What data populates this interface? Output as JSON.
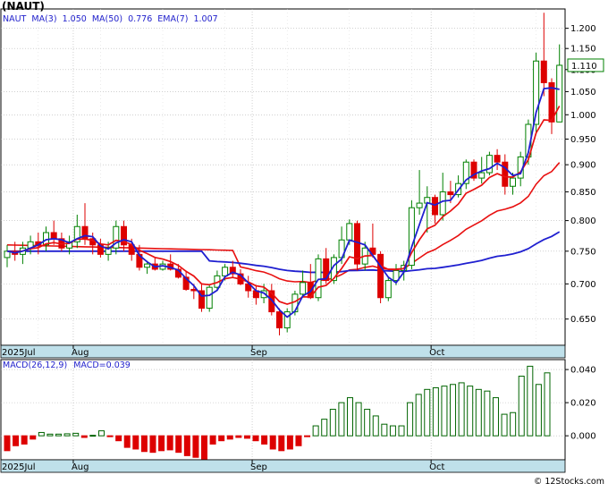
{
  "ticker": "(NAUT)",
  "legend": {
    "ma3": "MA(3)",
    "ma3_val": "1.050",
    "ma50": "MA(50)",
    "ma50_val": "0.776",
    "ema7": "EMA(7)",
    "ema7_val": "1.007"
  },
  "macd_legend": {
    "label": "MACD(26,12,9)",
    "value": "MACD=0.039"
  },
  "credit": "© 12Stocks.com",
  "last_price": "1.110",
  "colors": {
    "up": "#008000",
    "down": "#dd0000",
    "ma_blue": "#1f1fd0",
    "ma_red": "#e81010",
    "grid": "#b4b4b4",
    "axis_band": "#bfe0ea",
    "macd_bar": "#006400"
  },
  "chart_data": [
    {
      "type": "candlestick",
      "title": "(NAUT)",
      "x_labels": [
        "2025Jul",
        "Aug",
        "Sep",
        "Oct"
      ],
      "y_ticks": [
        "0.650",
        "0.700",
        "0.750",
        "0.800",
        "0.850",
        "0.900",
        "0.950",
        "1.000",
        "1.050",
        "1.100",
        "1.150",
        "1.200"
      ],
      "y_scale": "log",
      "ylim": [
        0.615,
        1.25
      ],
      "grid": true,
      "candles": [
        [
          0.74,
          0.76,
          0.725,
          0.75
        ],
        [
          0.75,
          0.765,
          0.735,
          0.745
        ],
        [
          0.745,
          0.765,
          0.73,
          0.755
        ],
        [
          0.755,
          0.775,
          0.745,
          0.765
        ],
        [
          0.765,
          0.78,
          0.745,
          0.76
        ],
        [
          0.76,
          0.79,
          0.75,
          0.78
        ],
        [
          0.78,
          0.8,
          0.76,
          0.77
        ],
        [
          0.77,
          0.78,
          0.75,
          0.755
        ],
        [
          0.755,
          0.775,
          0.745,
          0.765
        ],
        [
          0.765,
          0.81,
          0.755,
          0.79
        ],
        [
          0.79,
          0.83,
          0.76,
          0.77
        ],
        [
          0.77,
          0.78,
          0.745,
          0.76
        ],
        [
          0.76,
          0.77,
          0.74,
          0.745
        ],
        [
          0.745,
          0.765,
          0.735,
          0.755
        ],
        [
          0.755,
          0.8,
          0.745,
          0.79
        ],
        [
          0.79,
          0.8,
          0.75,
          0.76
        ],
        [
          0.76,
          0.77,
          0.735,
          0.745
        ],
        [
          0.745,
          0.76,
          0.72,
          0.725
        ],
        [
          0.725,
          0.735,
          0.715,
          0.73
        ],
        [
          0.73,
          0.74,
          0.72,
          0.722
        ],
        [
          0.722,
          0.735,
          0.72,
          0.73
        ],
        [
          0.73,
          0.745,
          0.72,
          0.722
        ],
        [
          0.722,
          0.73,
          0.708,
          0.71
        ],
        [
          0.71,
          0.72,
          0.69,
          0.692
        ],
        [
          0.692,
          0.7,
          0.678,
          0.69
        ],
        [
          0.69,
          0.7,
          0.66,
          0.665
        ],
        [
          0.665,
          0.7,
          0.66,
          0.695
        ],
        [
          0.695,
          0.72,
          0.69,
          0.712
        ],
        [
          0.712,
          0.73,
          0.705,
          0.725
        ],
        [
          0.725,
          0.735,
          0.71,
          0.715
        ],
        [
          0.715,
          0.722,
          0.698,
          0.7
        ],
        [
          0.7,
          0.712,
          0.68,
          0.69
        ],
        [
          0.69,
          0.698,
          0.67,
          0.68
        ],
        [
          0.68,
          0.7,
          0.672,
          0.69
        ],
        [
          0.69,
          0.7,
          0.655,
          0.66
        ],
        [
          0.66,
          0.665,
          0.628,
          0.638
        ],
        [
          0.638,
          0.665,
          0.632,
          0.66
        ],
        [
          0.66,
          0.69,
          0.655,
          0.685
        ],
        [
          0.685,
          0.72,
          0.68,
          0.702
        ],
        [
          0.702,
          0.73,
          0.678,
          0.68
        ],
        [
          0.68,
          0.745,
          0.675,
          0.738
        ],
        [
          0.738,
          0.755,
          0.7,
          0.705
        ],
        [
          0.705,
          0.745,
          0.7,
          0.74
        ],
        [
          0.74,
          0.79,
          0.73,
          0.768
        ],
        [
          0.768,
          0.802,
          0.76,
          0.795
        ],
        [
          0.795,
          0.8,
          0.72,
          0.73
        ],
        [
          0.73,
          0.765,
          0.72,
          0.755
        ],
        [
          0.755,
          0.795,
          0.74,
          0.745
        ],
        [
          0.745,
          0.75,
          0.672,
          0.68
        ],
        [
          0.68,
          0.71,
          0.675,
          0.705
        ],
        [
          0.705,
          0.73,
          0.698,
          0.72
        ],
        [
          0.72,
          0.735,
          0.705,
          0.728
        ],
        [
          0.728,
          0.835,
          0.722,
          0.822
        ],
        [
          0.822,
          0.89,
          0.81,
          0.83
        ],
        [
          0.83,
          0.86,
          0.78,
          0.84
        ],
        [
          0.84,
          0.845,
          0.795,
          0.81
        ],
        [
          0.81,
          0.885,
          0.8,
          0.85
        ],
        [
          0.85,
          0.87,
          0.83,
          0.845
        ],
        [
          0.845,
          0.88,
          0.84,
          0.865
        ],
        [
          0.865,
          0.91,
          0.855,
          0.905
        ],
        [
          0.905,
          0.91,
          0.87,
          0.875
        ],
        [
          0.875,
          0.915,
          0.865,
          0.885
        ],
        [
          0.885,
          0.925,
          0.88,
          0.918
        ],
        [
          0.918,
          0.93,
          0.89,
          0.905
        ],
        [
          0.905,
          0.92,
          0.845,
          0.86
        ],
        [
          0.86,
          0.885,
          0.845,
          0.875
        ],
        [
          0.875,
          0.925,
          0.86,
          0.915
        ],
        [
          0.915,
          0.99,
          0.9,
          0.98
        ],
        [
          0.98,
          1.14,
          0.96,
          1.12
        ],
        [
          1.12,
          1.24,
          1.04,
          1.07
        ],
        [
          1.07,
          1.08,
          0.96,
          0.985
        ],
        [
          0.985,
          1.16,
          0.985,
          1.11
        ]
      ]
    },
    {
      "type": "bar",
      "title": "MACD(26,12,9)",
      "value_label": "MACD=0.039",
      "y_ticks": [
        "0.000",
        "0.020",
        "0.040"
      ],
      "ylim": [
        -0.0145,
        0.046
      ],
      "values": [
        -0.009,
        -0.006,
        -0.005,
        -0.002,
        0.002,
        0.001,
        0.001,
        0.0012,
        0.0015,
        -0.001,
        0.0003,
        0.003,
        -0.0005,
        -0.003,
        -0.007,
        -0.008,
        -0.0095,
        -0.01,
        -0.009,
        -0.0085,
        -0.01,
        -0.012,
        -0.013,
        -0.014,
        -0.005,
        -0.003,
        -0.002,
        -0.001,
        -0.0015,
        -0.003,
        -0.005,
        -0.008,
        -0.009,
        -0.008,
        -0.006,
        -0.0005,
        0.006,
        0.01,
        0.016,
        0.02,
        0.023,
        0.02,
        0.016,
        0.012,
        0.007,
        0.006,
        0.006,
        0.02,
        0.025,
        0.028,
        0.029,
        0.03,
        0.031,
        0.032,
        0.03,
        0.028,
        0.027,
        0.023,
        0.013,
        0.014,
        0.036,
        0.042,
        0.031,
        0.038
      ]
    }
  ]
}
